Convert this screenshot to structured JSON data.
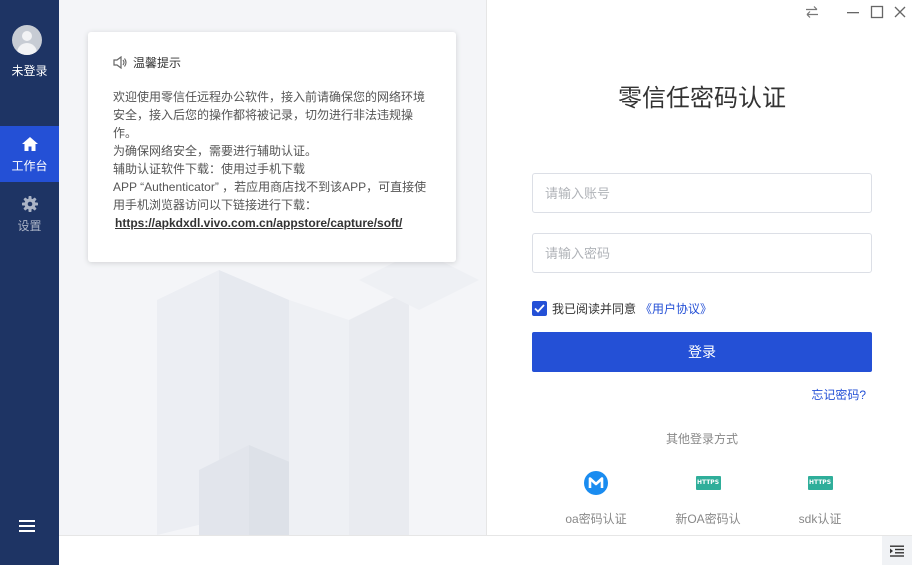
{
  "sidebar": {
    "user_label": "未登录",
    "items": [
      {
        "label": "工作台",
        "icon": "home-icon",
        "active": true
      },
      {
        "label": "设置",
        "icon": "gear-icon",
        "active": false
      }
    ]
  },
  "notice": {
    "title": "温馨提示",
    "paragraphs": [
      "欢迎使用零信任远程办公软件，接入前请确保您的网络环境安全，接入后您的操作都将被记录，切勿进行非法违规操作。",
      "为确保网络安全，需要进行辅助认证。",
      "辅助认证软件下载：使用过手机下载",
      "APP “Authenticator” ，若应用商店找不到该APP，可直接使用手机浏览器访问以下链接进行下载："
    ],
    "link": "https://apkdxdl.vivo.com.cn/appstore/capture/soft/"
  },
  "login": {
    "title": "零信任密码认证",
    "account_placeholder": "请输入账号",
    "password_placeholder": "请输入密码",
    "agree_text": "我已阅读并同意",
    "agree_link": "《用户协议》",
    "agree_checked": true,
    "submit_label": "登录",
    "forgot_label": "忘记密码?",
    "other_methods_title": "其他登录方式",
    "methods": [
      {
        "label": "oa密码认证",
        "icon": "m-logo-icon"
      },
      {
        "label": "新OA密码认",
        "icon": "https-icon",
        "badge": "HTTPS"
      },
      {
        "label": "sdk认证",
        "icon": "https-icon",
        "badge": "HTTPS"
      }
    ]
  },
  "colors": {
    "sidebar": "#1e3464",
    "accent": "#2450d6",
    "https_badge": "#2fae9a"
  }
}
